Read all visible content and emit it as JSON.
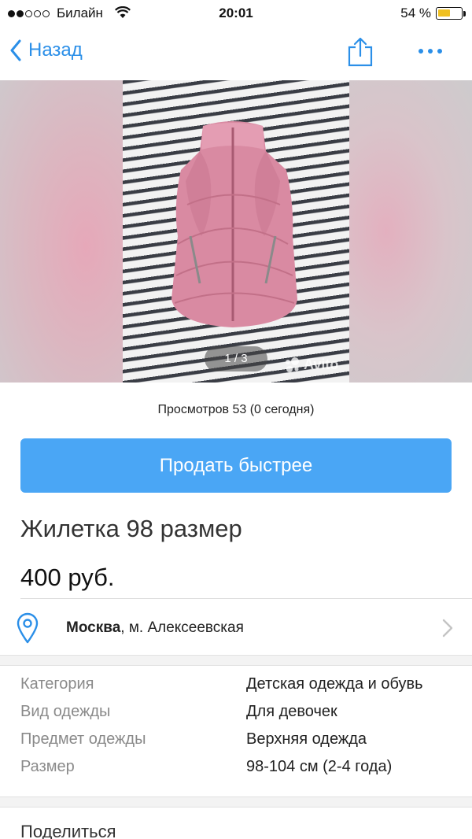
{
  "status_bar": {
    "carrier": "Билайн",
    "time": "20:01",
    "battery": "54 %",
    "battery_level": 0.54
  },
  "nav": {
    "back_label": "Назад"
  },
  "gallery": {
    "counter": "1 / 3",
    "watermark": "Avito"
  },
  "views": "Просмотров 53 (0 сегодня)",
  "sell_button": "Продать быстрее",
  "ad": {
    "title": "Жилетка 98 размер",
    "price": "400 руб."
  },
  "location": {
    "city": "Москва",
    "metro": ", м. Алексеевская"
  },
  "params": [
    {
      "label": "Категория",
      "value": "Детская одежда и обувь"
    },
    {
      "label": "Вид одежды",
      "value": "Для девочек"
    },
    {
      "label": "Предмет одежды",
      "value": "Верхняя одежда"
    },
    {
      "label": "Размер",
      "value": "98-104 см (2-4 года)"
    }
  ],
  "share_title": "Поделиться",
  "colors": {
    "accent": "#2b8fe8",
    "button": "#4aa6f5",
    "vest": "#d98aa2"
  },
  "icons": [
    "signal-icon",
    "wifi-icon",
    "battery-icon",
    "back-chevron-icon",
    "share-icon",
    "more-icon",
    "location-pin-icon",
    "chevron-right-icon",
    "avito-logo-icon"
  ]
}
